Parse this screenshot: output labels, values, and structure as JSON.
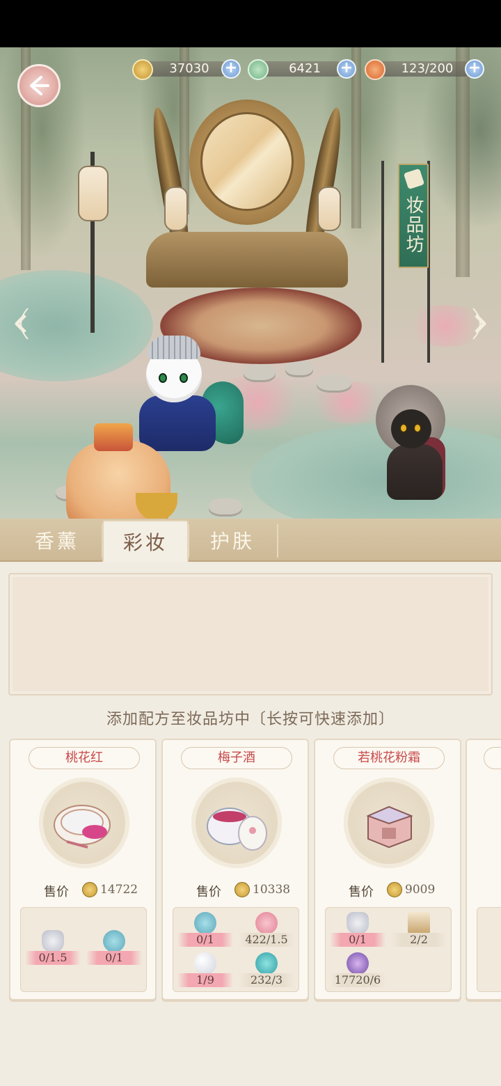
{
  "resources": [
    {
      "icon": "paw-coin-icon",
      "value": "37030"
    },
    {
      "icon": "jade-bird-icon",
      "value": "6421"
    },
    {
      "icon": "fruit-basket-icon",
      "value": "123/200"
    }
  ],
  "banner_text": "妆品坊",
  "tabs": [
    {
      "label": "香薰",
      "active": false
    },
    {
      "label": "彩妆",
      "active": true
    },
    {
      "label": "护肤",
      "active": false
    }
  ],
  "hint": "添加配方至妆品坊中〔长按可快速添加〕",
  "recipes": [
    {
      "name": "桃花红",
      "price_label": "售价",
      "price": "14722",
      "materials": [
        {
          "icon": "wine-bottle-icon",
          "value": "0/1.5",
          "lack": true
        },
        {
          "icon": "cream-jar-icon",
          "value": "0/1",
          "lack": true
        }
      ]
    },
    {
      "name": "梅子酒",
      "price_label": "售价",
      "price": "10338",
      "materials": [
        {
          "icon": "cream-jar-icon",
          "value": "0/1",
          "lack": true
        },
        {
          "icon": "petal-icon",
          "value": "422/1.5",
          "lack": false
        },
        {
          "icon": "pearl-icon",
          "value": "1/9",
          "lack": true
        },
        {
          "icon": "blue-flower-icon",
          "value": "232/3",
          "lack": false
        }
      ]
    },
    {
      "name": "若桃花粉霜",
      "price_label": "售价",
      "price": "9009",
      "materials": [
        {
          "icon": "wine-bottle-icon",
          "value": "0/1",
          "lack": true
        },
        {
          "icon": "wooden-box-icon",
          "value": "2/2",
          "lack": false
        },
        {
          "icon": "pansy-icon",
          "value": "17720/6",
          "lack": false
        }
      ]
    }
  ],
  "colors": {
    "recipe_name": "#c74a4a",
    "lack_bar": "#f3a7b0",
    "plus_button": "#6e9bd2",
    "banner": "#3f8a6d"
  }
}
